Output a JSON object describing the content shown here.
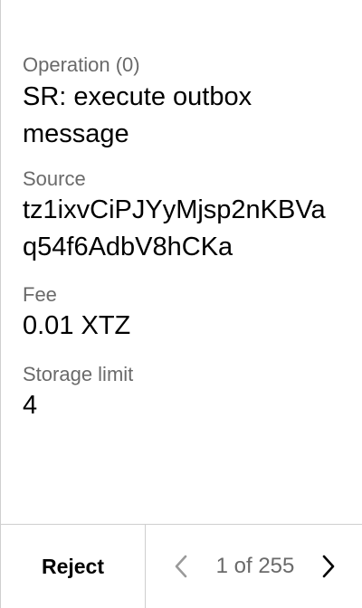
{
  "operation": {
    "label": "Operation (0)",
    "value": "SR: execute outbox message"
  },
  "source": {
    "label": "Source",
    "value": "tz1ixvCiPJYyMjsp2nKBVaq54f6AdbV8hCKa"
  },
  "fee": {
    "label": "Fee",
    "value": "0.01 XTZ"
  },
  "storage_limit": {
    "label": "Storage limit",
    "value": "4"
  },
  "footer": {
    "reject_label": "Reject",
    "page_indicator": "1 of 255",
    "prev_icon": "chevron-left-icon",
    "next_icon": "chevron-right-icon"
  },
  "colors": {
    "label": "#6a6a6a",
    "value": "#000000",
    "divider": "#cfcfcf",
    "prev_arrow_disabled": "#9a9a9a"
  }
}
